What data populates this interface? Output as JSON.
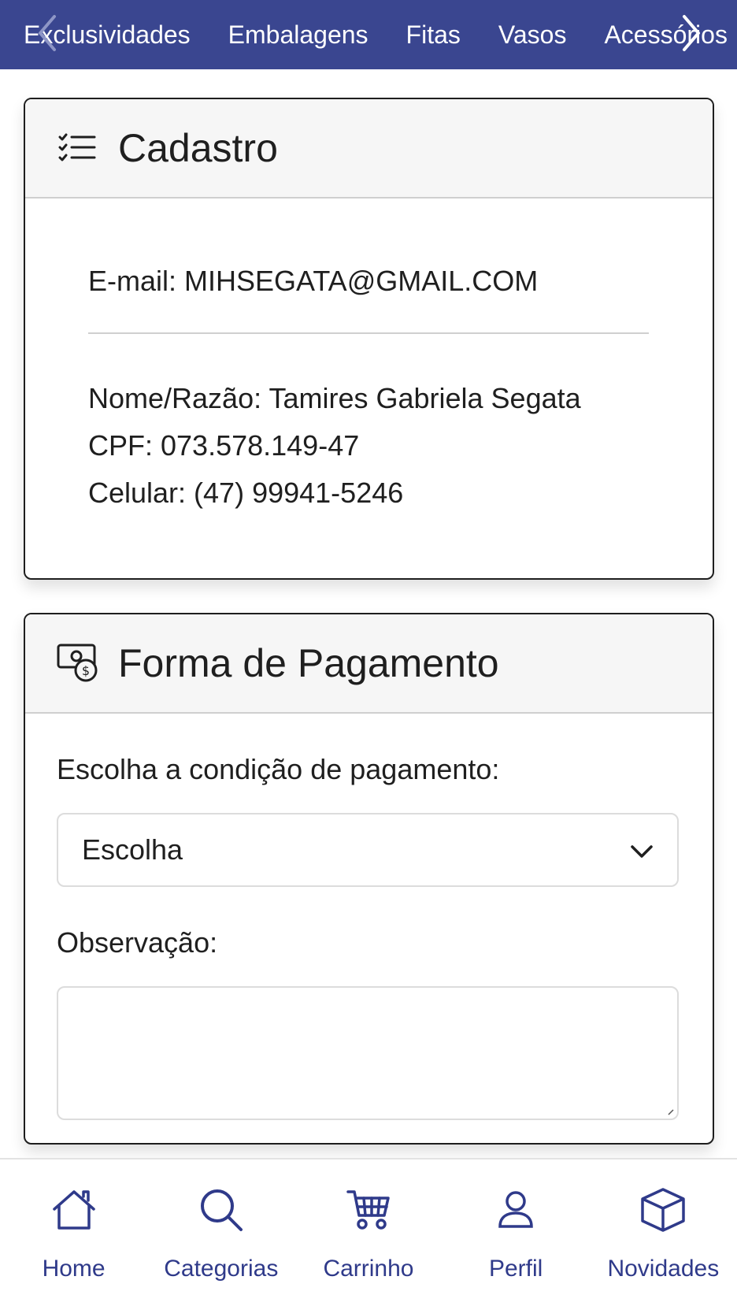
{
  "top_nav": {
    "categories": [
      "Exclusividades",
      "Embalagens",
      "Fitas",
      "Vasos",
      "Acessórios"
    ],
    "prev_icon": "chevron-left-icon",
    "next_icon": "chevron-right-icon"
  },
  "cadastro": {
    "title": "Cadastro",
    "icon": "checklist-icon",
    "email": "E-mail: MIHSEGATA@GMAIL.COM",
    "name": "Nome/Razão: Tamires Gabriela Segata",
    "cpf": "CPF: 073.578.149-47",
    "phone": "Celular: (47) 99941-5246"
  },
  "pagamento": {
    "title": "Forma de Pagamento",
    "icon": "money-icon",
    "condition_label": "Escolha a condição de pagamento:",
    "condition_selected": "Escolha",
    "observation_label": "Observação:",
    "observation_value": ""
  },
  "bottom_nav": {
    "items": [
      {
        "label": "Home",
        "icon": "home-icon"
      },
      {
        "label": "Categorias",
        "icon": "search-icon"
      },
      {
        "label": "Carrinho",
        "icon": "cart-icon"
      },
      {
        "label": "Perfil",
        "icon": "user-icon"
      },
      {
        "label": "Novidades",
        "icon": "box-icon"
      }
    ]
  },
  "colors": {
    "brand": "#3a4690",
    "nav_text": "#2f3a8a",
    "card_border": "#1e1e1e"
  }
}
